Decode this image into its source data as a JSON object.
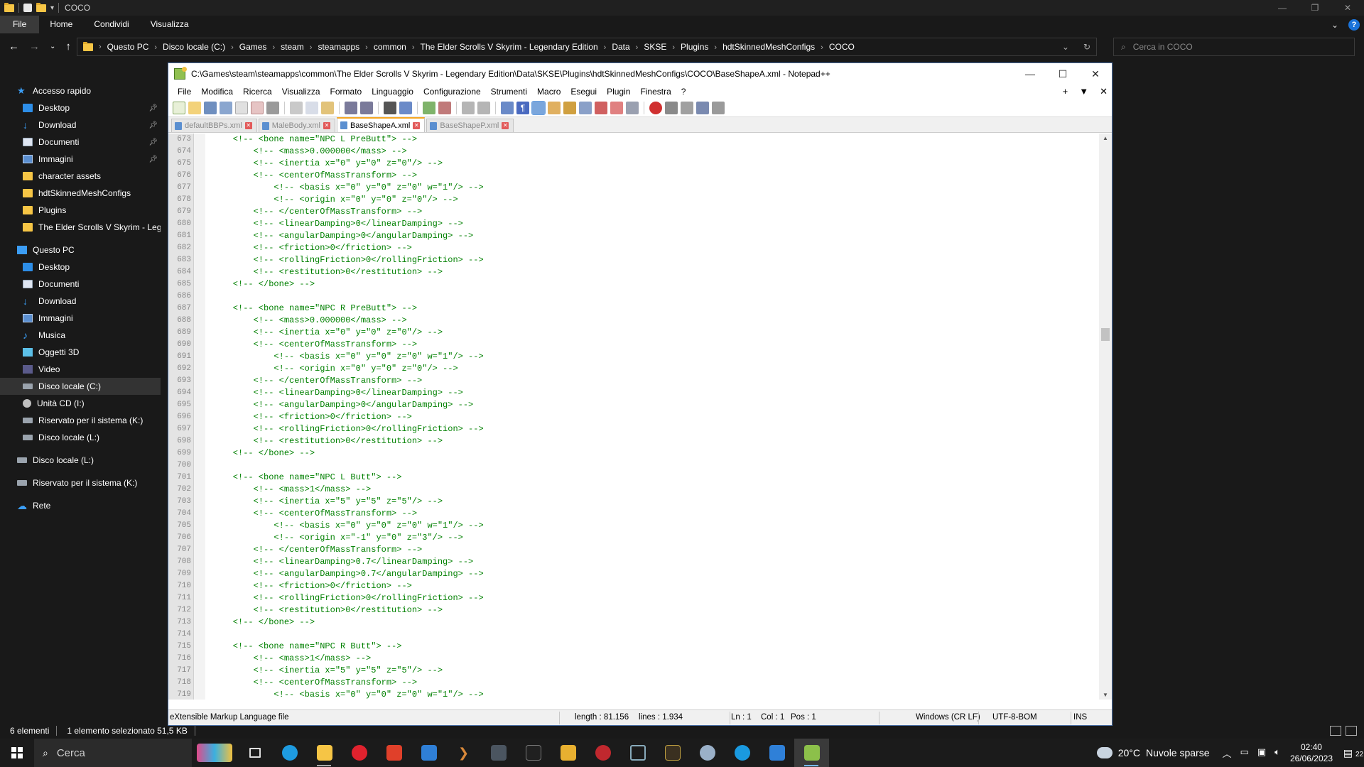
{
  "explorer": {
    "title": "COCO",
    "ribbon_tabs": [
      "File",
      "Home",
      "Condividi",
      "Visualizza"
    ],
    "breadcrumb": [
      "Questo PC",
      "Disco locale (C:)",
      "Games",
      "steam",
      "steamapps",
      "common",
      "The Elder Scrolls V Skyrim - Legendary Edition",
      "Data",
      "SKSE",
      "Plugins",
      "hdtSkinnedMeshConfigs",
      "COCO"
    ],
    "search_placeholder": "Cerca in COCO",
    "nav": [
      {
        "label": "Accesso rapido",
        "icon": "star-icon",
        "indent": 0,
        "pinned": false,
        "selected": false
      },
      {
        "label": "Desktop",
        "icon": "desktop-icon",
        "indent": 1,
        "pinned": true,
        "selected": false
      },
      {
        "label": "Download",
        "icon": "download-icon",
        "indent": 1,
        "pinned": true,
        "selected": false
      },
      {
        "label": "Documenti",
        "icon": "documents-icon",
        "indent": 1,
        "pinned": true,
        "selected": false
      },
      {
        "label": "Immagini",
        "icon": "pictures-icon",
        "indent": 1,
        "pinned": true,
        "selected": false
      },
      {
        "label": "character assets",
        "icon": "folder-icon",
        "indent": 1,
        "pinned": false,
        "selected": false
      },
      {
        "label": "hdtSkinnedMeshConfigs",
        "icon": "folder-icon",
        "indent": 1,
        "pinned": false,
        "selected": false
      },
      {
        "label": "Plugins",
        "icon": "folder-icon",
        "indent": 1,
        "pinned": false,
        "selected": false
      },
      {
        "label": "The Elder Scrolls V Skyrim - Leger",
        "icon": "folder-icon",
        "indent": 1,
        "pinned": false,
        "selected": false
      },
      {
        "label": "Questo PC",
        "icon": "pc-icon",
        "indent": 0,
        "pinned": false,
        "selected": false
      },
      {
        "label": "Desktop",
        "icon": "desktop-icon",
        "indent": 1,
        "pinned": false,
        "selected": false
      },
      {
        "label": "Documenti",
        "icon": "documents-icon",
        "indent": 1,
        "pinned": false,
        "selected": false
      },
      {
        "label": "Download",
        "icon": "download-icon",
        "indent": 1,
        "pinned": false,
        "selected": false
      },
      {
        "label": "Immagini",
        "icon": "pictures-icon",
        "indent": 1,
        "pinned": false,
        "selected": false
      },
      {
        "label": "Musica",
        "icon": "music-icon",
        "indent": 1,
        "pinned": false,
        "selected": false
      },
      {
        "label": "Oggetti 3D",
        "icon": "objects-3d-icon",
        "indent": 1,
        "pinned": false,
        "selected": false
      },
      {
        "label": "Video",
        "icon": "video-icon",
        "indent": 1,
        "pinned": false,
        "selected": false
      },
      {
        "label": "Disco locale (C:)",
        "icon": "drive-icon",
        "indent": 1,
        "pinned": false,
        "selected": true
      },
      {
        "label": "Unità CD (I:)",
        "icon": "cd-drive-icon",
        "indent": 1,
        "pinned": false,
        "selected": false
      },
      {
        "label": "Riservato per il sistema (K:)",
        "icon": "drive-icon",
        "indent": 1,
        "pinned": false,
        "selected": false
      },
      {
        "label": "Disco locale (L:)",
        "icon": "drive-icon",
        "indent": 1,
        "pinned": false,
        "selected": false
      },
      {
        "label": "Disco locale (L:)",
        "icon": "drive-icon",
        "indent": 0,
        "pinned": false,
        "selected": false
      },
      {
        "label": "Riservato per il sistema (K:)",
        "icon": "drive-icon",
        "indent": 0,
        "pinned": false,
        "selected": false
      },
      {
        "label": "Rete",
        "icon": "network-icon",
        "indent": 0,
        "pinned": false,
        "selected": false
      }
    ],
    "status": {
      "items": "6 elementi",
      "selected": "1 elemento selezionato  51,5 KB"
    }
  },
  "npp": {
    "title": "C:\\Games\\steam\\steamapps\\common\\The Elder Scrolls V Skyrim - Legendary Edition\\Data\\SKSE\\Plugins\\hdtSkinnedMeshConfigs\\COCO\\BaseShapeA.xml - Notepad++",
    "menu": [
      "File",
      "Modifica",
      "Ricerca",
      "Visualizza",
      "Formato",
      "Linguaggio",
      "Configurazione",
      "Strumenti",
      "Macro",
      "Esegui",
      "Plugin",
      "Finestra",
      "?"
    ],
    "tabs": [
      {
        "label": "defaultBBPs.xml",
        "active": false
      },
      {
        "label": "MaleBody.xml",
        "active": false
      },
      {
        "label": "BaseShapeA.xml",
        "active": true
      },
      {
        "label": "BaseShapeP.xml",
        "active": false
      }
    ],
    "lines": [
      {
        "n": "673",
        "t": "    <!-- <bone name=\"NPC L PreButt\"> -->"
      },
      {
        "n": "674",
        "t": "        <!-- <mass>0.000000</mass> -->"
      },
      {
        "n": "675",
        "t": "        <!-- <inertia x=\"0\" y=\"0\" z=\"0\"/> -->"
      },
      {
        "n": "676",
        "t": "        <!-- <centerOfMassTransform> -->"
      },
      {
        "n": "677",
        "t": "            <!-- <basis x=\"0\" y=\"0\" z=\"0\" w=\"1\"/> -->"
      },
      {
        "n": "678",
        "t": "            <!-- <origin x=\"0\" y=\"0\" z=\"0\"/> -->"
      },
      {
        "n": "679",
        "t": "        <!-- </centerOfMassTransform> -->"
      },
      {
        "n": "680",
        "t": "        <!-- <linearDamping>0</linearDamping> -->"
      },
      {
        "n": "681",
        "t": "        <!-- <angularDamping>0</angularDamping> -->"
      },
      {
        "n": "682",
        "t": "        <!-- <friction>0</friction> -->"
      },
      {
        "n": "683",
        "t": "        <!-- <rollingFriction>0</rollingFriction> -->"
      },
      {
        "n": "684",
        "t": "        <!-- <restitution>0</restitution> -->"
      },
      {
        "n": "685",
        "t": "    <!-- </bone> -->"
      },
      {
        "n": "686",
        "t": ""
      },
      {
        "n": "687",
        "t": "    <!-- <bone name=\"NPC R PreButt\"> -->"
      },
      {
        "n": "688",
        "t": "        <!-- <mass>0.000000</mass> -->"
      },
      {
        "n": "689",
        "t": "        <!-- <inertia x=\"0\" y=\"0\" z=\"0\"/> -->"
      },
      {
        "n": "690",
        "t": "        <!-- <centerOfMassTransform> -->"
      },
      {
        "n": "691",
        "t": "            <!-- <basis x=\"0\" y=\"0\" z=\"0\" w=\"1\"/> -->"
      },
      {
        "n": "692",
        "t": "            <!-- <origin x=\"0\" y=\"0\" z=\"0\"/> -->"
      },
      {
        "n": "693",
        "t": "        <!-- </centerOfMassTransform> -->"
      },
      {
        "n": "694",
        "t": "        <!-- <linearDamping>0</linearDamping> -->"
      },
      {
        "n": "695",
        "t": "        <!-- <angularDamping>0</angularDamping> -->"
      },
      {
        "n": "696",
        "t": "        <!-- <friction>0</friction> -->"
      },
      {
        "n": "697",
        "t": "        <!-- <rollingFriction>0</rollingFriction> -->"
      },
      {
        "n": "698",
        "t": "        <!-- <restitution>0</restitution> -->"
      },
      {
        "n": "699",
        "t": "    <!-- </bone> -->"
      },
      {
        "n": "700",
        "t": ""
      },
      {
        "n": "701",
        "t": "    <!-- <bone name=\"NPC L Butt\"> -->"
      },
      {
        "n": "702",
        "t": "        <!-- <mass>1</mass> -->"
      },
      {
        "n": "703",
        "t": "        <!-- <inertia x=\"5\" y=\"5\" z=\"5\"/> -->"
      },
      {
        "n": "704",
        "t": "        <!-- <centerOfMassTransform> -->"
      },
      {
        "n": "705",
        "t": "            <!-- <basis x=\"0\" y=\"0\" z=\"0\" w=\"1\"/> -->"
      },
      {
        "n": "706",
        "t": "            <!-- <origin x=\"-1\" y=\"0\" z=\"3\"/> -->"
      },
      {
        "n": "707",
        "t": "        <!-- </centerOfMassTransform> -->"
      },
      {
        "n": "708",
        "t": "        <!-- <linearDamping>0.7</linearDamping> -->"
      },
      {
        "n": "709",
        "t": "        <!-- <angularDamping>0.7</angularDamping> -->"
      },
      {
        "n": "710",
        "t": "        <!-- <friction>0</friction> -->"
      },
      {
        "n": "711",
        "t": "        <!-- <rollingFriction>0</rollingFriction> -->"
      },
      {
        "n": "712",
        "t": "        <!-- <restitution>0</restitution> -->"
      },
      {
        "n": "713",
        "t": "    <!-- </bone> -->"
      },
      {
        "n": "714",
        "t": ""
      },
      {
        "n": "715",
        "t": "    <!-- <bone name=\"NPC R Butt\"> -->"
      },
      {
        "n": "716",
        "t": "        <!-- <mass>1</mass> -->"
      },
      {
        "n": "717",
        "t": "        <!-- <inertia x=\"5\" y=\"5\" z=\"5\"/> -->"
      },
      {
        "n": "718",
        "t": "        <!-- <centerOfMassTransform> -->"
      },
      {
        "n": "719",
        "t": "            <!-- <basis x=\"0\" y=\"0\" z=\"0\" w=\"1\"/> -->"
      }
    ],
    "status": {
      "filetype": "eXtensible Markup Language file",
      "length": "length : 81.156",
      "lines": "lines : 1.934",
      "ln": "Ln : 1",
      "col": "Col : 1",
      "pos": "Pos : 1",
      "eol": "Windows (CR LF)",
      "encoding": "UTF-8-BOM",
      "mode": "INS"
    }
  },
  "taskbar": {
    "search_placeholder": "Cerca",
    "weather": {
      "temp": "20°C",
      "desc": "Nuvole sparse"
    },
    "time": "02:40",
    "date": "26/06/2023",
    "notif_count": "22"
  },
  "colors": {
    "code_comment": "#008000",
    "accent_tab": "#f5a623",
    "explorer_bg": "#191919"
  }
}
